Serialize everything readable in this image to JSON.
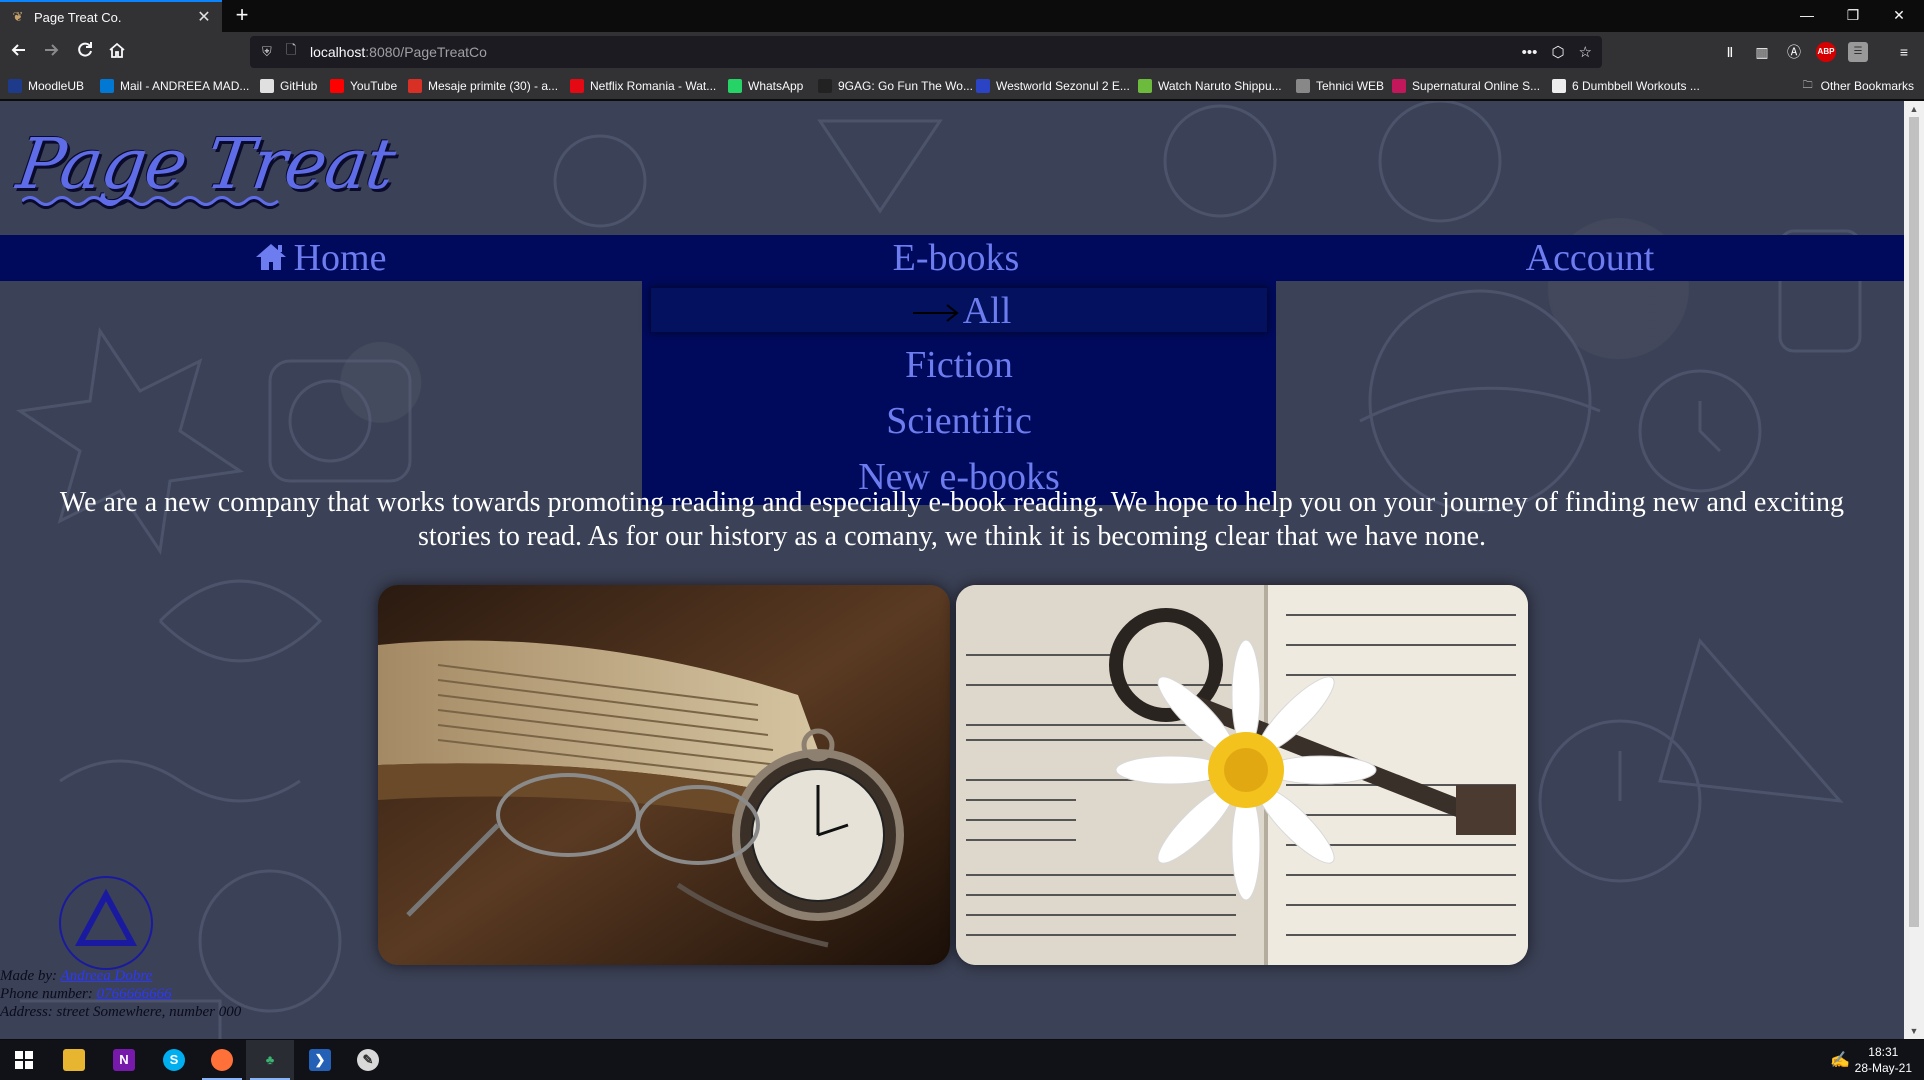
{
  "browser": {
    "tab_title": "Page Treat Co.",
    "url_host": "localhost",
    "url_path": ":8080/PageTreatCo",
    "bookmarks": [
      {
        "label": "MoodleUB",
        "color": "#1e3a8a"
      },
      {
        "label": "Mail - ANDREEA MAD...",
        "color": "#0078d4"
      },
      {
        "label": "GitHub",
        "color": "#e0e0e0"
      },
      {
        "label": "YouTube",
        "color": "#ff0000"
      },
      {
        "label": "Mesaje primite (30) - a...",
        "color": "#d93025"
      },
      {
        "label": "Netflix Romania - Wat...",
        "color": "#e50914"
      },
      {
        "label": "WhatsApp",
        "color": "#25d366"
      },
      {
        "label": "9GAG: Go Fun The Wo...",
        "color": "#222222"
      },
      {
        "label": "Westworld Sezonul 2 E...",
        "color": "#2b44c5"
      },
      {
        "label": "Watch Naruto Shippu...",
        "color": "#6dbb3c"
      },
      {
        "label": "Tehnici WEB",
        "color": "#888888"
      },
      {
        "label": "Supernatural Online S...",
        "color": "#c2185b"
      },
      {
        "label": "6 Dumbbell Workouts ...",
        "color": "#eeeeee"
      }
    ],
    "other_bookmarks": "Other Bookmarks"
  },
  "page": {
    "logo": "Page Treat",
    "nav": {
      "home": "Home",
      "ebooks": "E-books",
      "account": "Account"
    },
    "dropdown": {
      "all": "All",
      "fiction": "Fiction",
      "scientific": "Scientific",
      "new": "New e-books"
    },
    "intro": "We are a new company that works towards promoting reading and especially e-book reading. We hope to help you on your journey of finding new and exciting stories to read. As for our history as a comany, we think it is becoming clear that we have none.",
    "footer": {
      "made_by_label": "Made by:",
      "made_by_name": "Andreea Dobre",
      "phone_label": "Phone number:",
      "phone": "0766666666",
      "address": "Address: street Somewhere, number 000"
    }
  },
  "taskbar": {
    "time": "18:31",
    "date": "28-May-21"
  },
  "colors": {
    "nav_bg": "#000a5c",
    "nav_text": "#6d7df0",
    "page_bg": "#3b4156"
  }
}
